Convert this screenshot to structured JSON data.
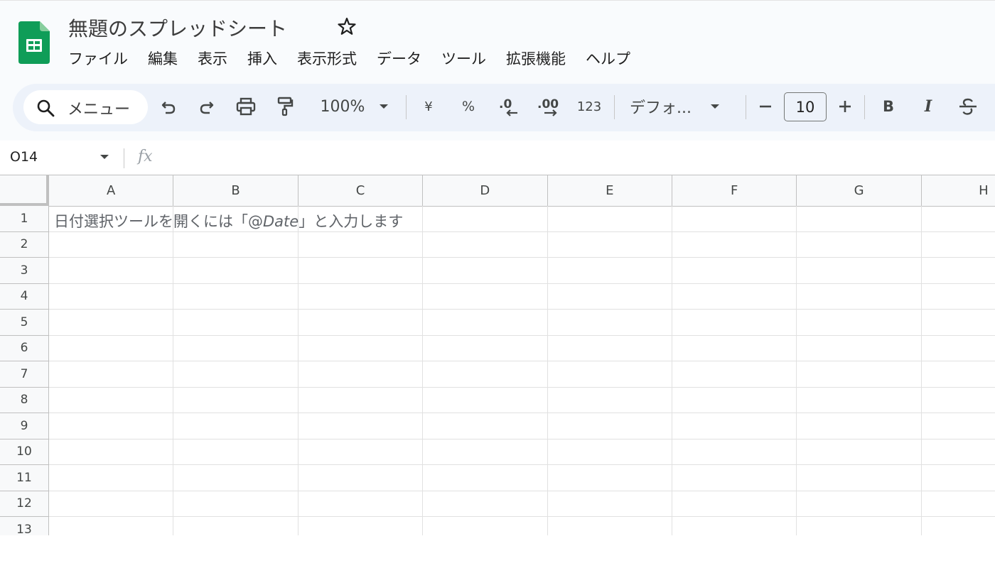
{
  "document": {
    "title": "無題のスプレッドシート"
  },
  "menu": [
    "ファイル",
    "編集",
    "表示",
    "挿入",
    "表示形式",
    "データ",
    "ツール",
    "拡張機能",
    "ヘルプ"
  ],
  "toolbar": {
    "search_label": "メニュー",
    "zoom": "100%",
    "currency": "¥",
    "percent": "%",
    "more_formats": "123",
    "font": "デフォ...",
    "font_size": "10",
    "bold": "B",
    "italic": "I"
  },
  "formula_bar": {
    "cell_ref": "O14",
    "fx": "fx"
  },
  "columns": [
    "A",
    "B",
    "C",
    "D",
    "E",
    "F",
    "G",
    "H"
  ],
  "rows": [
    "1",
    "2",
    "3",
    "4",
    "5",
    "6",
    "7",
    "8",
    "9",
    "10",
    "11",
    "12",
    "13"
  ],
  "cells": {
    "A1_hint_pre": "日付選択ツールを開くには「@",
    "A1_hint_italic": "Date",
    "A1_hint_post": "」と入力します"
  },
  "colors": {
    "logo_green": "#0f9d58",
    "toolbar_bg": "#edf2fa",
    "header_bg": "#f9fbfd"
  },
  "icons": [
    "sheets-logo-icon",
    "star-icon",
    "search-icon",
    "undo-icon",
    "redo-icon",
    "print-icon",
    "paint-format-icon",
    "chevron-down-icon",
    "decrease-decimal-icon",
    "increase-decimal-icon",
    "minus-icon",
    "plus-icon",
    "strikethrough-icon"
  ]
}
